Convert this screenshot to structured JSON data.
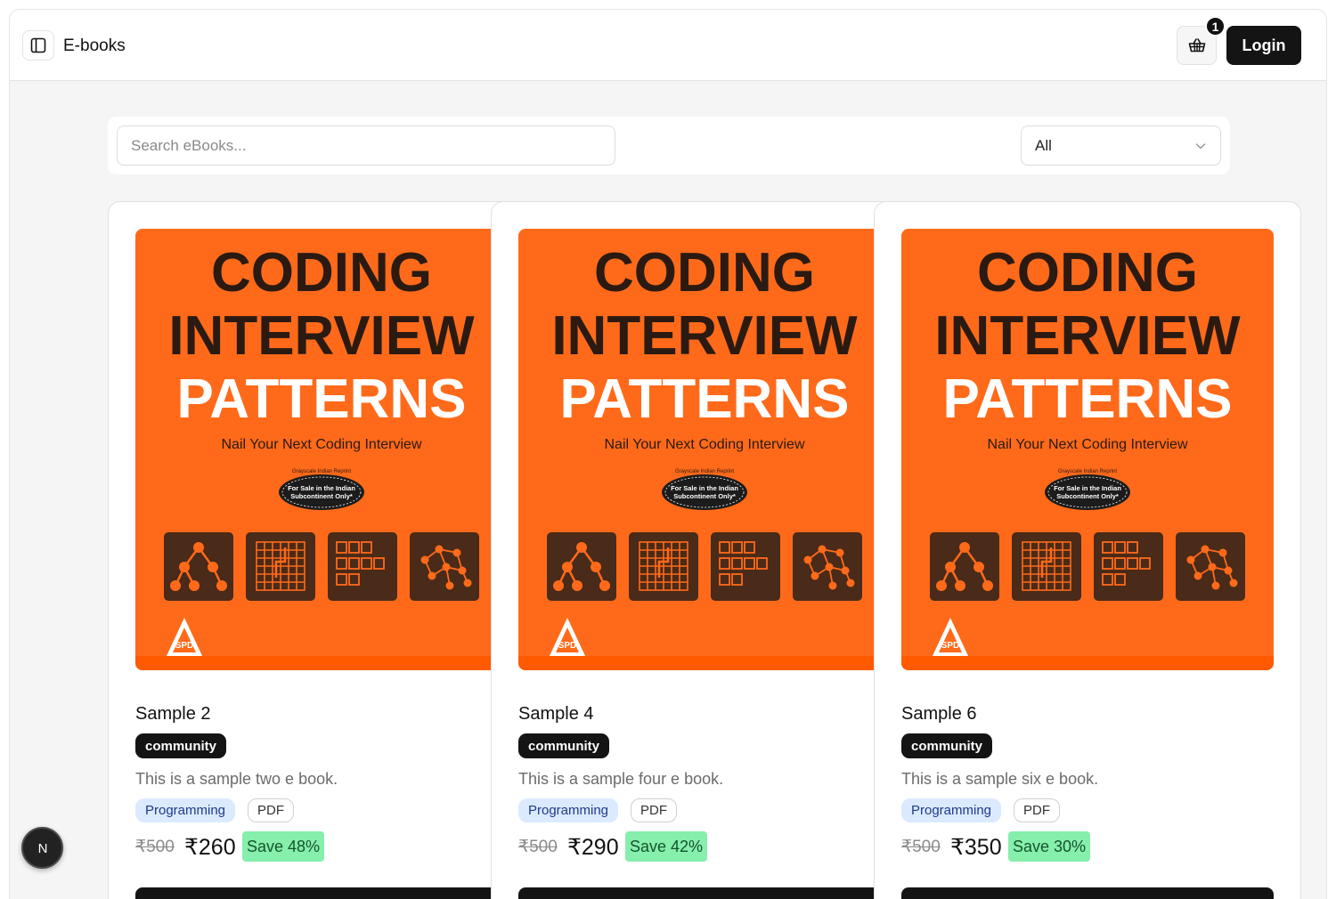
{
  "header": {
    "title": "E-books",
    "cart_count": "1",
    "login_label": "Login",
    "icons": [
      "sidebar-panel-icon",
      "basket-icon"
    ]
  },
  "filters": {
    "search_placeholder": "Search eBooks...",
    "category_value": "All"
  },
  "cover": {
    "line1": "CODING",
    "line2": "INTERVIEW",
    "line3": "PATTERNS",
    "subtitle": "Nail Your Next Coding Interview",
    "seal_top": "Grayscale Indian Reprint",
    "seal_line1": "For Sale in the Indian",
    "seal_line2": "Subcontinent Only*",
    "publisher": "SPD"
  },
  "books": [
    {
      "title": "Sample 2",
      "tag": "community",
      "description": "This is a sample two e book.",
      "genre": "Programming",
      "format": "PDF",
      "original_price": "₹500",
      "price": "₹260",
      "save": "Save 48%"
    },
    {
      "title": "Sample 4",
      "tag": "community",
      "description": "This is a sample four e book.",
      "genre": "Programming",
      "format": "PDF",
      "original_price": "₹500",
      "price": "₹290",
      "save": "Save 42%"
    },
    {
      "title": "Sample 6",
      "tag": "community",
      "description": "This is a sample six e book.",
      "genre": "Programming",
      "format": "PDF",
      "original_price": "₹500",
      "price": "₹350",
      "save": "Save 30%"
    }
  ],
  "dev_badge": {
    "letter": "N"
  },
  "colors": {
    "cover_orange": "#ff6a1a",
    "cover_icon_tile": "#4a2a18",
    "dark": "#141414",
    "genre_pill_bg": "#dbeafe",
    "save_badge_bg": "#86efac"
  }
}
